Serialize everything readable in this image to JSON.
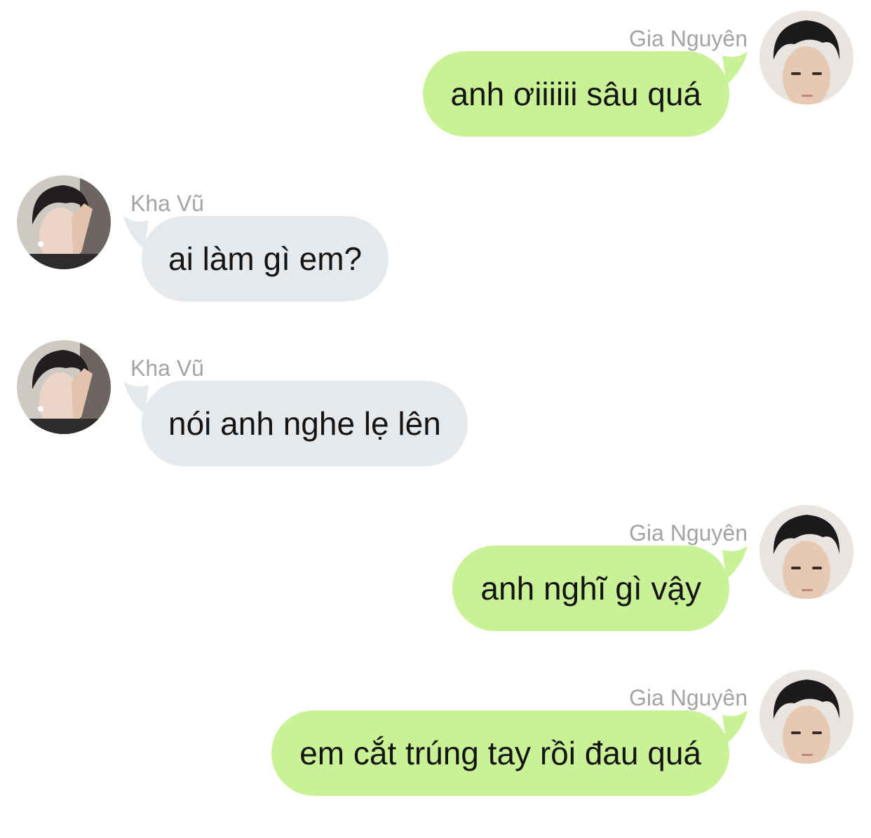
{
  "colors": {
    "outgoing_bubble": "#c9f196",
    "incoming_bubble": "#e6e9ec",
    "sender_name": "#a3a3a3",
    "text": "#141414"
  },
  "messages": [
    {
      "sender": "Gia Nguyên",
      "direction": "outgoing",
      "text": "anh ơiiiiii sâu quá",
      "avatar_icon": "avatar-gia-nguyen"
    },
    {
      "sender": "Kha Vũ",
      "direction": "incoming",
      "text": "ai làm gì em?",
      "avatar_icon": "avatar-kha-vu"
    },
    {
      "sender": "Kha Vũ",
      "direction": "incoming",
      "text": "nói anh nghe lẹ lên",
      "avatar_icon": "avatar-kha-vu"
    },
    {
      "sender": "Gia Nguyên",
      "direction": "outgoing",
      "text": "anh nghĩ gì vậy",
      "avatar_icon": "avatar-gia-nguyen"
    },
    {
      "sender": "Gia Nguyên",
      "direction": "outgoing",
      "text": "em cắt trúng tay rồi đau quá",
      "avatar_icon": "avatar-gia-nguyen"
    }
  ]
}
